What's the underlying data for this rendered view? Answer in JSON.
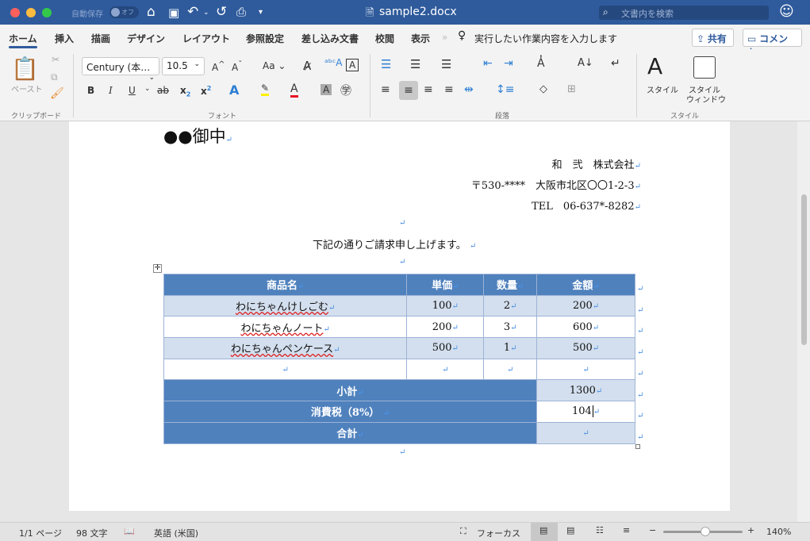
{
  "titlebar": {
    "autosave_label": "自動保存",
    "autosave_state": "オフ",
    "doc_title": "sample2.docx",
    "search_placeholder": "文書内を検索"
  },
  "tabs": [
    {
      "label": "ホーム",
      "active": true
    },
    {
      "label": "挿入"
    },
    {
      "label": "描画"
    },
    {
      "label": "デザイン"
    },
    {
      "label": "レイアウト"
    },
    {
      "label": "参照設定"
    },
    {
      "label": "差し込み文書"
    },
    {
      "label": "校閲"
    },
    {
      "label": "表示"
    }
  ],
  "tell_me": "実行したい作業内容を入力します",
  "share_label": "共有",
  "comment_label": "コメント",
  "ribbon": {
    "paste_label": "ペースト",
    "clipboard_group": "クリップボード",
    "font_name": "Century (本…",
    "font_size": "10.5",
    "font_group": "フォント",
    "paragraph_group": "段落",
    "styles_label": "スタイル",
    "styles_pane_label1": "スタイル",
    "styles_pane_label2": "ウィンドウ",
    "styles_group": "スタイル",
    "bold": "B",
    "italic": "I",
    "underline": "U",
    "strike": "ab",
    "change_case": "Aa",
    "grow": "A",
    "shrink": "A"
  },
  "document": {
    "addressee": "●●御中",
    "company": "和　弐　株式会社",
    "address": "〒530-****　大阪市北区〇〇1-2-3",
    "tel": "TEL　06-637*-8282",
    "intro": "下記の通りご請求申し上げます。",
    "table": {
      "headers": [
        "商品名",
        "単価",
        "数量",
        "金額"
      ],
      "rows": [
        [
          "わにちゃんけしごむ",
          "100",
          "2",
          "200"
        ],
        [
          "わにちゃんノート",
          "200",
          "3",
          "600"
        ],
        [
          "わにちゃんペンケース",
          "500",
          "1",
          "500"
        ],
        [
          "",
          "",
          "",
          ""
        ]
      ],
      "subtotal_label": "小計",
      "subtotal": "1300",
      "tax_label": "消費税（8%）",
      "tax": "104",
      "total_label": "合計",
      "total": ""
    }
  },
  "status": {
    "page": "1/1 ページ",
    "words": "98 文字",
    "language": "英語 (米国)",
    "focus": "フォーカス",
    "zoom": "140%",
    "zoom_percent": 140
  }
}
